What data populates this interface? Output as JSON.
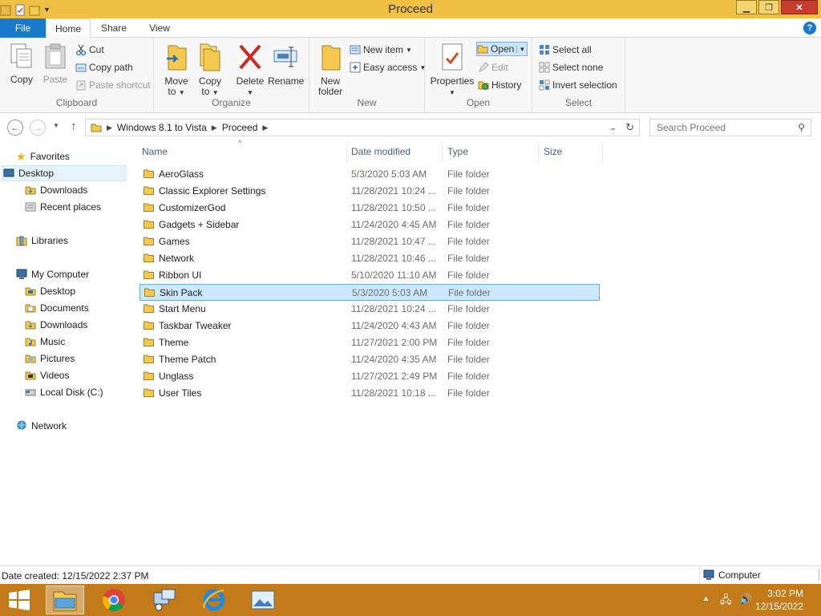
{
  "window": {
    "title": "Proceed"
  },
  "tabs": {
    "file": "File",
    "home": "Home",
    "share": "Share",
    "view": "View"
  },
  "ribbon": {
    "clipboard": {
      "label": "Clipboard",
      "copy": "Copy",
      "paste": "Paste",
      "cut": "Cut",
      "copy_path": "Copy path",
      "paste_shortcut": "Paste shortcut"
    },
    "organize": {
      "label": "Organize",
      "move_to": "Move",
      "move_to2": "to",
      "copy_to": "Copy",
      "copy_to2": "to",
      "delete": "Delete",
      "rename": "Rename"
    },
    "new": {
      "label": "New",
      "new_folder": "New",
      "new_folder2": "folder",
      "new_item": "New item",
      "easy_access": "Easy access"
    },
    "open": {
      "label": "Open",
      "properties": "Properties",
      "open": "Open",
      "edit": "Edit",
      "history": "History"
    },
    "select": {
      "label": "Select",
      "select_all": "Select all",
      "select_none": "Select none",
      "invert": "Invert selection"
    }
  },
  "address": {
    "crumbs": [
      "Windows 8.1 to Vista",
      "Proceed"
    ],
    "search_placeholder": "Search Proceed"
  },
  "nav": {
    "favorites": "Favorites",
    "desktop": "Desktop",
    "downloads": "Downloads",
    "recent": "Recent places",
    "libraries": "Libraries",
    "computer": "My Computer",
    "c_desktop": "Desktop",
    "c_documents": "Documents",
    "c_downloads": "Downloads",
    "c_music": "Music",
    "c_pictures": "Pictures",
    "c_videos": "Videos",
    "c_disk": "Local Disk (C:)",
    "network": "Network"
  },
  "columns": {
    "name": "Name",
    "date": "Date modified",
    "type": "Type",
    "size": "Size"
  },
  "files": [
    {
      "name": "AeroGlass",
      "date": "5/3/2020 5:03 AM",
      "type": "File folder"
    },
    {
      "name": "Classic Explorer Settings",
      "date": "11/28/2021 10:24 ...",
      "type": "File folder"
    },
    {
      "name": "CustomizerGod",
      "date": "11/28/2021 10:50 ...",
      "type": "File folder"
    },
    {
      "name": "Gadgets + Sidebar",
      "date": "11/24/2020 4:45 AM",
      "type": "File folder"
    },
    {
      "name": "Games",
      "date": "11/28/2021 10:47 ...",
      "type": "File folder"
    },
    {
      "name": "Network",
      "date": "11/28/2021 10:46 ...",
      "type": "File folder"
    },
    {
      "name": "Ribbon UI",
      "date": "5/10/2020 11:10 AM",
      "type": "File folder"
    },
    {
      "name": "Skin Pack",
      "date": "5/3/2020 5:03 AM",
      "type": "File folder"
    },
    {
      "name": "Start Menu",
      "date": "11/28/2021 10:24 ...",
      "type": "File folder"
    },
    {
      "name": "Taskbar Tweaker",
      "date": "11/24/2020 4:43 AM",
      "type": "File folder"
    },
    {
      "name": "Theme",
      "date": "11/27/2021 2:00 PM",
      "type": "File folder"
    },
    {
      "name": "Theme Patch",
      "date": "11/24/2020 4:35 AM",
      "type": "File folder"
    },
    {
      "name": "Unglass",
      "date": "11/27/2021 2:49 PM",
      "type": "File folder"
    },
    {
      "name": "User Tiles",
      "date": "11/28/2021 10:18 ...",
      "type": "File folder"
    }
  ],
  "selected_file": "Skin Pack",
  "status": {
    "info": "Date created: 12/15/2022 2:37 PM",
    "location": "Computer"
  },
  "taskbar": {
    "time": "3:02 PM",
    "date": "12/15/2022"
  },
  "colors": {
    "titlebar": "#f0c044",
    "file_tab": "#1979ca",
    "taskbar": "#c27a1a",
    "selection": "#cce8ff"
  }
}
